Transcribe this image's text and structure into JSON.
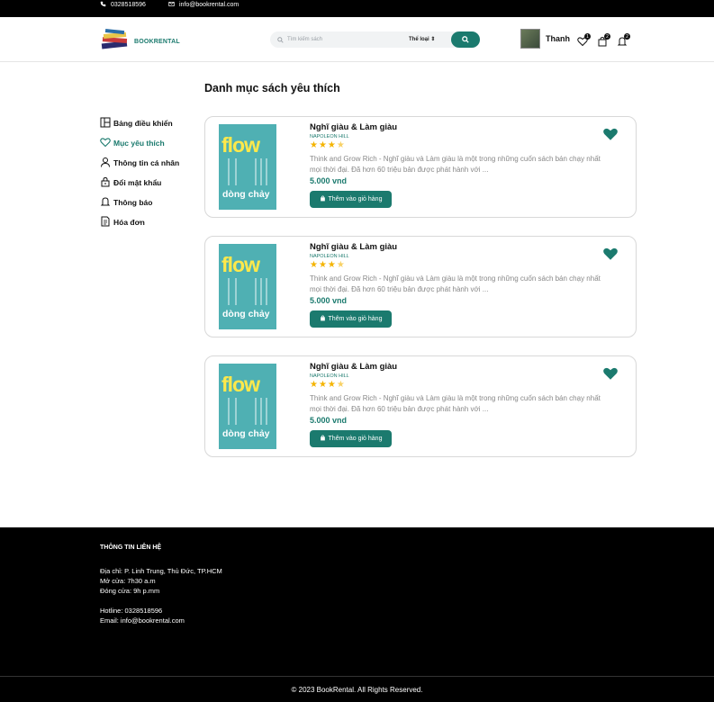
{
  "topbar": {
    "phone": "0328518596",
    "email": "info@bookrental.com"
  },
  "header": {
    "logo_text": "BOOKRENTAL",
    "search_placeholder": "Tìm kiếm sách",
    "category_label": "Thể loại",
    "user_name": "Thanh",
    "wishlist_count": "1",
    "cart_count": "2",
    "notification_count": "2"
  },
  "page": {
    "title": "Danh mục sách yêu thích"
  },
  "sidebar": {
    "items": [
      {
        "label": "Bảng điều khiển",
        "icon": "dashboard-icon"
      },
      {
        "label": "Mục yêu thích",
        "icon": "heart-icon"
      },
      {
        "label": "Thông tin cá nhân",
        "icon": "user-icon"
      },
      {
        "label": "Đổi mật khẩu",
        "icon": "lock-icon"
      },
      {
        "label": "Thông báo",
        "icon": "bell-icon"
      },
      {
        "label": "Hóa đơn",
        "icon": "invoice-icon"
      }
    ]
  },
  "books": [
    {
      "title": "Nghĩ giàu & Làm giàu",
      "author": "NAPOLEON HILL",
      "rating": 3.5,
      "description": "Think and Grow Rich - Nghĩ giàu và Làm giàu là một trong những cuốn sách bán chạy nhất mọi thời đại. Đã hơn 60 triệu bản được phát hành với ...",
      "price": "5.000 vnd",
      "cart_label": "Thêm vào giỏ hàng",
      "cover_title": "flow",
      "cover_subtitle": "dòng chảy"
    },
    {
      "title": "Nghĩ giàu & Làm giàu",
      "author": "NAPOLEON HILL",
      "rating": 3.5,
      "description": "Think and Grow Rich - Nghĩ giàu và Làm giàu là một trong những cuốn sách bán chạy nhất mọi thời đại. Đã hơn 60 triệu bản được phát hành với ...",
      "price": "5.000 vnd",
      "cart_label": "Thêm vào giỏ hàng",
      "cover_title": "flow",
      "cover_subtitle": "dòng chảy"
    },
    {
      "title": "Nghĩ giàu & Làm giàu",
      "author": "NAPOLEON HILL",
      "rating": 3.5,
      "description": "Think and Grow Rich - Nghĩ giàu và Làm giàu là một trong những cuốn sách bán chạy nhất mọi thời đại. Đã hơn 60 triệu bản được phát hành với ...",
      "price": "5.000 vnd",
      "cart_label": "Thêm vào giỏ hàng",
      "cover_title": "flow",
      "cover_subtitle": "dòng chảy"
    }
  ],
  "footer": {
    "title": "THÔNG TIN LIÊN HỆ",
    "address": "Địa chỉ: P. Linh Trung, Thủ Đức, TP.HCM",
    "open": "Mở cửa: 7h30 a.m",
    "close": "Đóng cửa: 9h p.mm",
    "hotline": "Hotline: 0328518596",
    "email": "Email: info@bookrental.com",
    "copyright": "© 2023 BookRental. All Rights Reserved."
  },
  "colors": {
    "accent": "#1b7a6e",
    "star": "#f4b400"
  }
}
